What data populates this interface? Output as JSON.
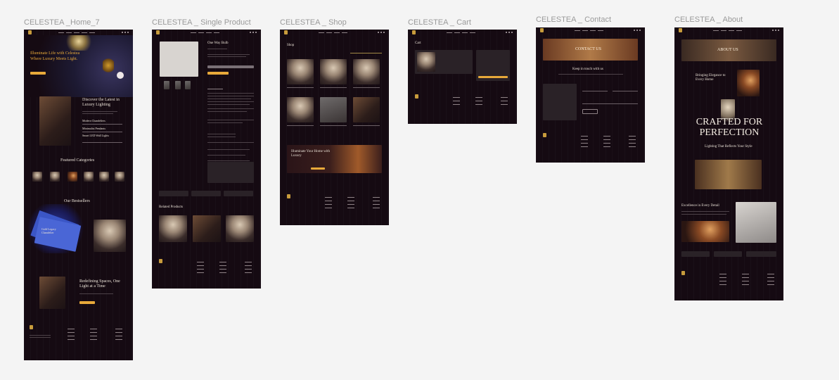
{
  "frames": {
    "home": {
      "label": "CELESTEA _Home_7",
      "hero_title": "Illuminate Life with Celestea",
      "hero_subtitle": "Where Luxury Meets Light.",
      "discover_title": "Discover the Latest in Luxury Lighting",
      "accordion": [
        "Modern Chandeliers",
        "Minimalist Pendants",
        "Smart LED Wall Lights"
      ],
      "featured_title": "Featured Categories",
      "bestsellers_title": "Our Bestsellers",
      "bestseller_card": "Gold Legacy Chandelier",
      "redefining_title": "Redefining Spaces, One Light at a Time"
    },
    "single_product": {
      "label": "CELESTEA _ Single Product",
      "product_title": "One Way Bulb",
      "related_title": "Related Products"
    },
    "shop": {
      "label": "CELESTEA _ Shop",
      "page_title": "Shop",
      "banner_title": "Illuminate Your Home with Luxury"
    },
    "cart": {
      "label": "CELESTEA _ Cart",
      "page_title": "Cart"
    },
    "contact": {
      "label": "CELESTEA _ Contact",
      "banner_title": "CONTACT US",
      "keep_title": "Keep in touch with us"
    },
    "about": {
      "label": "CELESTEA _ About",
      "banner_title": "ABOUT US",
      "bringing_title": "Bringing Elegance to Every Home",
      "crafted_title": "CRAFTED FOR PERFECTION",
      "lighting_sub": "Lighting That Reflects Your Style",
      "excellence_title": "Excellence in Every Detail"
    }
  },
  "colors": {
    "canvas": "#f4f4f4",
    "page_bg": "#150a12",
    "accent": "#e8a93a"
  }
}
